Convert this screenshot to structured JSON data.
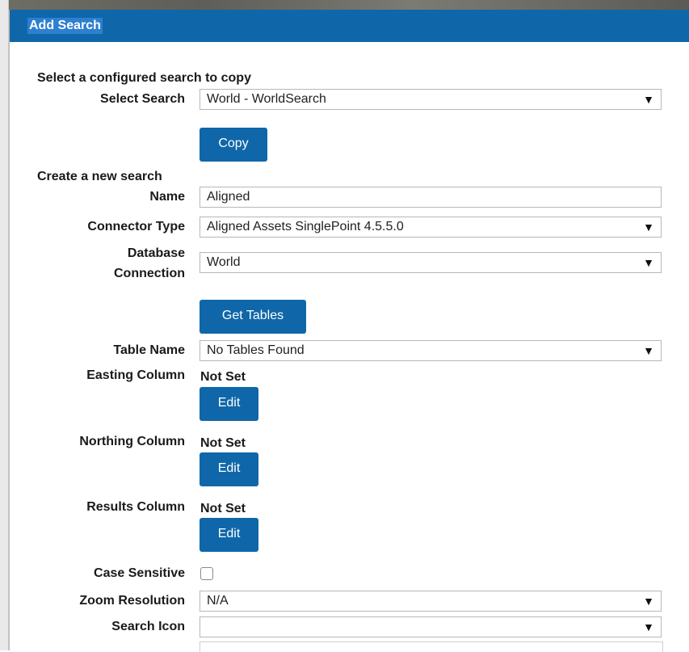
{
  "panel": {
    "title": "Add Search"
  },
  "copy_section": {
    "heading": "Select a configured search to copy",
    "select_label": "Select Search",
    "select_value": "World - WorldSearch",
    "copy_button": "Copy"
  },
  "new_section": {
    "heading": "Create a new search",
    "name_label": "Name",
    "name_value": "Aligned",
    "connector_label": "Connector Type",
    "connector_value": "Aligned Assets SinglePoint 4.5.5.0",
    "db_label_line1": "Database",
    "db_label_line2": "Connection",
    "db_value": "World",
    "get_tables_button": "Get Tables",
    "table_label": "Table Name",
    "table_value": "No Tables Found",
    "easting_label": "Easting Column",
    "easting_value": "Not Set",
    "northing_label": "Northing Column",
    "northing_value": "Not Set",
    "results_label": "Results Column",
    "results_value": "Not Set",
    "edit_button": "Edit",
    "case_label": "Case Sensitive",
    "case_checked": false,
    "zoom_label": "Zoom Resolution",
    "zoom_value": "N/A",
    "icon_label": "Search Icon",
    "icon_value": ""
  },
  "icons": {
    "dropdown": "▼"
  },
  "colors": {
    "brand": "#0f67a9",
    "title_highlight": "#2d7fd0"
  }
}
